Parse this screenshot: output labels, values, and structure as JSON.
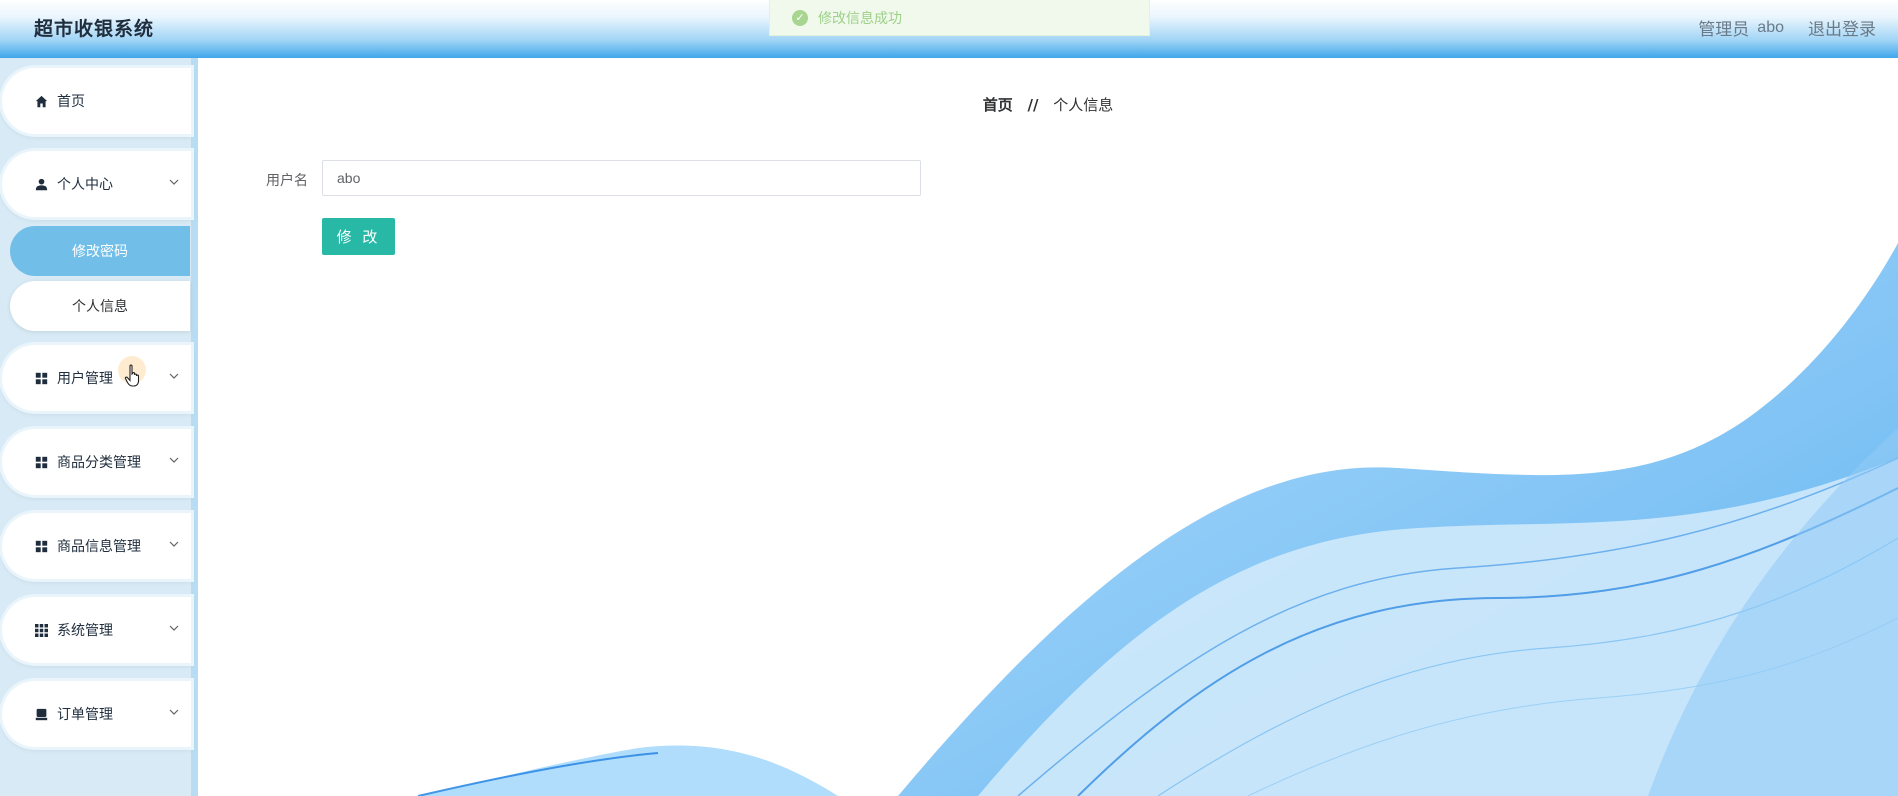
{
  "app": {
    "title": "超市收银系统"
  },
  "topbar": {
    "role_label": "管理员",
    "username": "abo",
    "logout_label": "退出登录"
  },
  "toast": {
    "message": "修改信息成功"
  },
  "sidebar": {
    "items": [
      {
        "label": "首页",
        "icon": "home-icon"
      },
      {
        "label": "个人中心",
        "icon": "user-icon"
      },
      {
        "label": "用户管理",
        "icon": "grid-icon"
      },
      {
        "label": "商品分类管理",
        "icon": "grid-icon"
      },
      {
        "label": "商品信息管理",
        "icon": "grid-icon"
      },
      {
        "label": "系统管理",
        "icon": "apps-icon"
      },
      {
        "label": "订单管理",
        "icon": "order-icon"
      }
    ],
    "submenu": [
      {
        "label": "修改密码",
        "active": true
      },
      {
        "label": "个人信息",
        "active": false
      }
    ]
  },
  "breadcrumb": {
    "home": "首页",
    "separator": "//",
    "current": "个人信息"
  },
  "form": {
    "username_label": "用户名",
    "username_value": "abo",
    "submit_label": "修 改"
  },
  "colors": {
    "accent": "#27b8a6",
    "submenu_active": "#71bfe9",
    "toast_bg": "#f0f9eb",
    "wave": "#3fa6ea"
  }
}
